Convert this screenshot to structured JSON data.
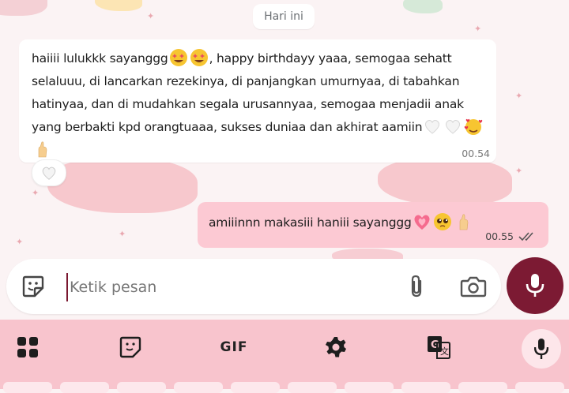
{
  "chat": {
    "date_label": "Hari ini",
    "incoming": {
      "text_parts": [
        "haiiii lulukkk sayanggg",
        ", happy birthdayy yaaa, semogaa sehatt selaluuu, di lancarkan rezekinya, di panjangkan umurnyaa, di tabahkan hatinyaa, dan di mudahkan segala urusannyaa, semogaa menjadii anak yang berbakti kpd orangtuaaa, sukses duniaa dan akhirat aamiin"
      ],
      "time": "00.54",
      "reaction": "white-heart"
    },
    "outgoing": {
      "text": "amiiinnn makasiii haniii sayanggg",
      "time": "00.55",
      "status": "read"
    }
  },
  "composer": {
    "placeholder": "Ketik pesan",
    "icons": [
      "sticker-icon",
      "attach-icon",
      "camera-icon",
      "mic-icon"
    ]
  },
  "keyboard": {
    "gif_label": "GIF",
    "icons": [
      "apps-grid-icon",
      "sticker-note-icon",
      "settings-gear-icon",
      "translate-icon",
      "mic-icon"
    ]
  },
  "colors": {
    "accent": "#7c1a33",
    "outgoing_bubble": "#fcc9d3",
    "keyboard_bg": "#f8c4cd"
  }
}
